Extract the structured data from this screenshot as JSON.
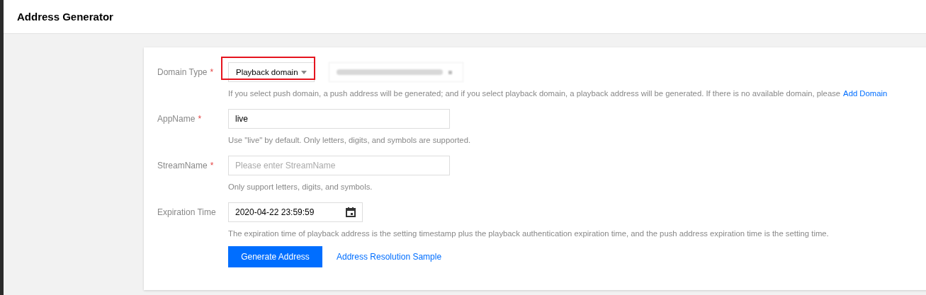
{
  "header": {
    "title": "Address Generator"
  },
  "form": {
    "fields": [
      {
        "kind": "select",
        "label": "Domain Type",
        "required_mark": "*",
        "value": "Playback domain",
        "highlighted": true,
        "redacted_extra": true,
        "help": "If you select push domain, a push address will be generated; and if you select playback domain, a playback address will be generated. If there is no available domain, please",
        "help_link": "Add Domain"
      },
      {
        "kind": "text",
        "label": "AppName",
        "required_mark": "*",
        "value": "live",
        "help": "Use \"live\" by default. Only letters, digits, and symbols are supported."
      },
      {
        "kind": "text",
        "label": "StreamName",
        "required_mark": "*",
        "placeholder": "Please enter StreamName",
        "help": "Only support letters, digits, and symbols."
      },
      {
        "kind": "date",
        "label": "Expiration Time",
        "value": "2020-04-22 23:59:59",
        "help": "The expiration time of playback address is the setting timestamp plus the playback authentication expiration time, and the push address expiration time is the setting time."
      }
    ],
    "submit": "Generate Address",
    "link": "Address Resolution Sample"
  }
}
